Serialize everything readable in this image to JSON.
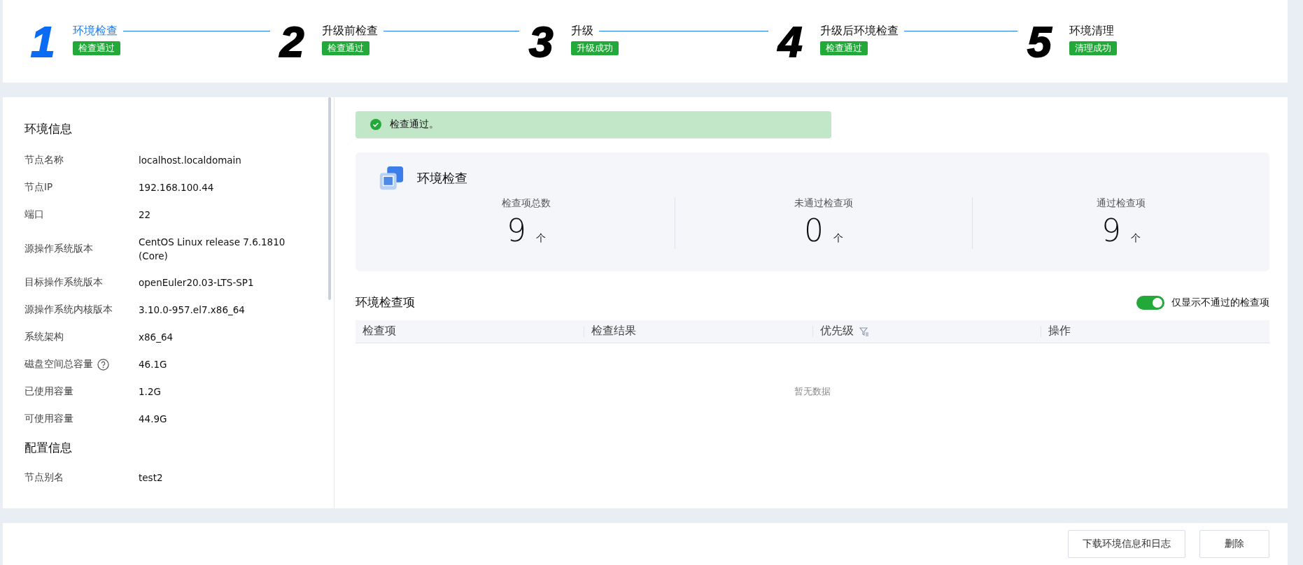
{
  "steps": [
    {
      "number": "1",
      "title": "环境检查",
      "status": "检查通过",
      "selected": true
    },
    {
      "number": "2",
      "title": "升级前检查",
      "status": "检查通过",
      "selected": false
    },
    {
      "number": "3",
      "title": "升级",
      "status": "升级成功",
      "selected": false
    },
    {
      "number": "4",
      "title": "升级后环境检查",
      "status": "检查通过",
      "selected": false
    },
    {
      "number": "5",
      "title": "环境清理",
      "status": "清理成功",
      "selected": false
    }
  ],
  "info_panel": {
    "sections": [
      {
        "title": "环境信息",
        "rows": [
          {
            "label": "节点名称",
            "value": "localhost.localdomain"
          },
          {
            "label": "节点IP",
            "value": "192.168.100.44"
          },
          {
            "label": "端口",
            "value": "22"
          },
          {
            "label": "源操作系统版本",
            "value": "CentOS Linux release 7.6.1810 (Core)"
          },
          {
            "label": "目标操作系统版本",
            "value": "openEuler20.03-LTS-SP1"
          },
          {
            "label": "源操作系统内核版本",
            "value": "3.10.0-957.el7.x86_64"
          },
          {
            "label": "系统架构",
            "value": "x86_64"
          },
          {
            "label": "磁盘空间总容量",
            "value": "46.1G",
            "help": true
          },
          {
            "label": "已使用容量",
            "value": "1.2G"
          },
          {
            "label": "可使用容量",
            "value": "44.9G"
          }
        ]
      },
      {
        "title": "配置信息",
        "rows": [
          {
            "label": "节点别名",
            "value": "test2"
          }
        ]
      }
    ]
  },
  "alert": {
    "message": "检查通过。"
  },
  "summary": {
    "title": "环境检查",
    "stats": [
      {
        "label": "检查项总数",
        "value": "9",
        "unit": "个"
      },
      {
        "label": "未通过检查项",
        "value": "0",
        "unit": "个"
      },
      {
        "label": "通过检查项",
        "value": "9",
        "unit": "个"
      }
    ]
  },
  "check_items": {
    "title": "环境检查项",
    "toggle": {
      "label": "仅显示不通过的检查项",
      "on": true
    },
    "columns": [
      {
        "label": "检查项",
        "filter": false
      },
      {
        "label": "检查结果",
        "filter": false
      },
      {
        "label": "优先级",
        "filter": true
      },
      {
        "label": "操作",
        "filter": false
      }
    ],
    "empty_text": "暂无数据"
  },
  "buttons": [
    "下载环境信息和日志",
    "删除"
  ]
}
